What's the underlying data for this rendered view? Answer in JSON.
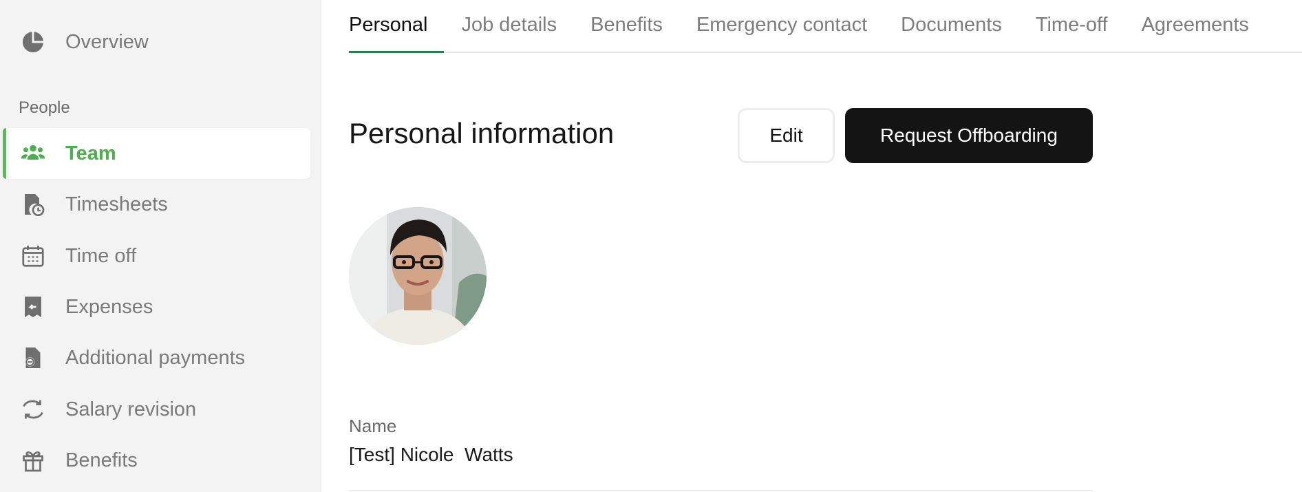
{
  "sidebar": {
    "overview": {
      "label": "Overview",
      "icon": "pie-chart-icon"
    },
    "section_label": "People",
    "items": [
      {
        "label": "Team",
        "icon": "team-icon",
        "active": true
      },
      {
        "label": "Timesheets",
        "icon": "timesheet-icon"
      },
      {
        "label": "Time off",
        "icon": "calendar-icon"
      },
      {
        "label": "Expenses",
        "icon": "receipt-icon"
      },
      {
        "label": "Additional payments",
        "icon": "payment-document-icon"
      },
      {
        "label": "Salary revision",
        "icon": "refresh-arrows-icon"
      },
      {
        "label": "Benefits",
        "icon": "gift-icon"
      }
    ]
  },
  "tabs": [
    {
      "label": "Personal",
      "active": true
    },
    {
      "label": "Job details"
    },
    {
      "label": "Benefits"
    },
    {
      "label": "Emergency contact"
    },
    {
      "label": "Documents"
    },
    {
      "label": "Time-off"
    },
    {
      "label": "Agreements"
    }
  ],
  "main": {
    "title": "Personal information",
    "edit_label": "Edit",
    "offboarding_label": "Request Offboarding",
    "fields": [
      {
        "label": "Name",
        "value": "[Test] Nicole  Watts"
      }
    ]
  },
  "colors": {
    "accent_green": "#4caf50",
    "tab_underline": "#2e7d4f",
    "primary_button": "#141414",
    "sidebar_bg": "#f3f3f3"
  }
}
